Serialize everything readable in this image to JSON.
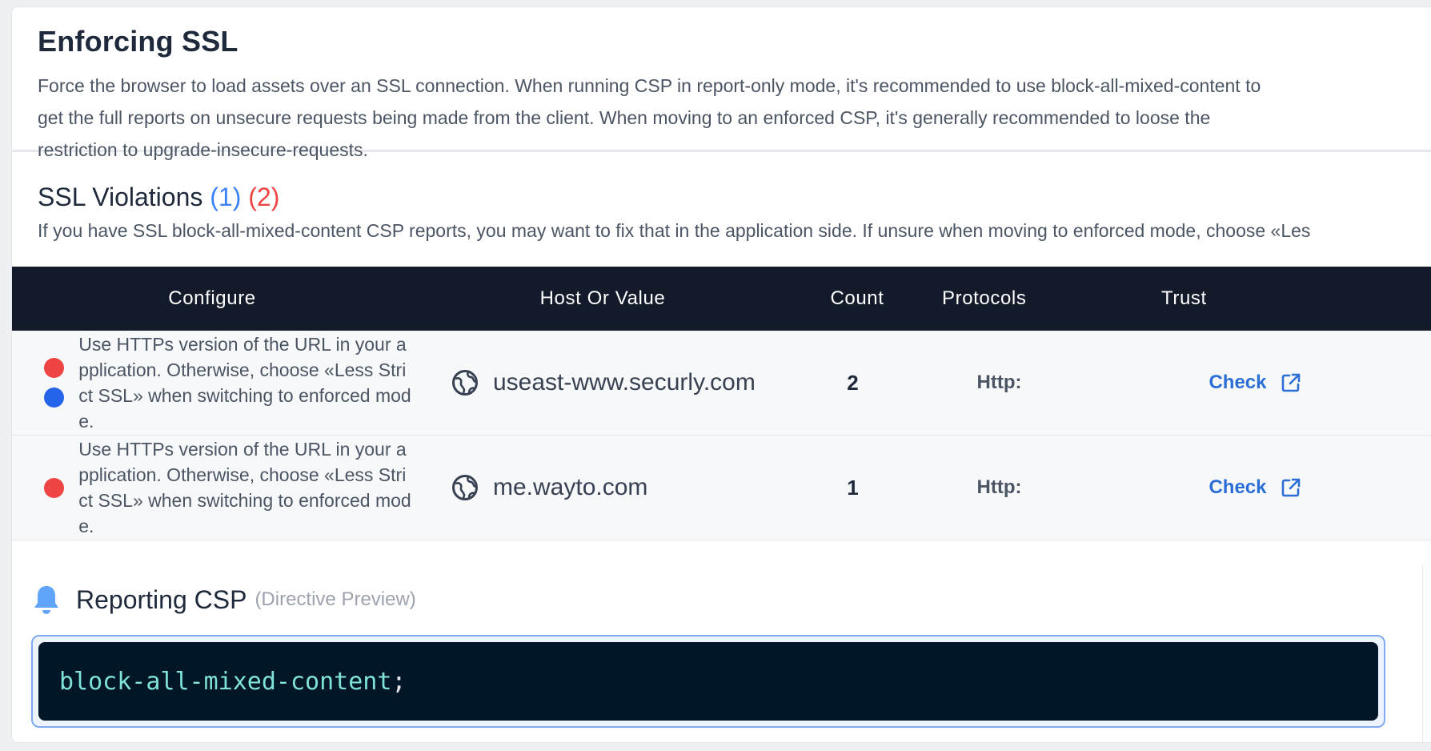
{
  "header": {
    "title": "Enforcing SSL",
    "description": "Force the browser to load assets over an SSL connection. When running CSP in report-only mode, it's recommended to use block-all-mixed-content to get the full reports on unsecure requests being made from the client. When moving to an enforced CSP, it's generally recommended to loose the restriction to upgrade-insecure-requests."
  },
  "ssl_violations": {
    "title": "SSL Violations",
    "count_blue": "(1)",
    "count_red": "(2)",
    "description": "If you have SSL block-all-mixed-content CSP reports, you may want to fix that in the application side. If unsure when moving to enforced mode, choose «Les"
  },
  "table": {
    "columns": [
      "Configure",
      "Host Or Value",
      "Count",
      "Protocols",
      "Trust"
    ],
    "rows": [
      {
        "configure": "Use HTTPs version of the URL in your application. Otherwise, choose «Less Strict SSL» when switching to enforced mode.",
        "dots": [
          "red",
          "blue"
        ],
        "host": "useast-www.securly.com",
        "count": "2",
        "protocols": "Http:",
        "trust": "Check"
      },
      {
        "configure": "Use HTTPs version of the URL in your application. Otherwise, choose «Less Strict SSL» when switching to enforced mode.",
        "dots": [
          "red"
        ],
        "host": "me.wayto.com",
        "count": "1",
        "protocols": "Http:",
        "trust": "Check"
      }
    ]
  },
  "reporting": {
    "icon": "bell-icon",
    "title": "Reporting CSP",
    "subtitle": "(Directive Preview)",
    "directive": "block-all-mixed-content",
    "terminator": ";"
  },
  "colors": {
    "accent_blue": "#3b82f6",
    "accent_red": "#ef4444",
    "table_header": "#131a2a",
    "code_bg": "#02162a",
    "code_text": "#7fe3d6",
    "link": "#2b6ed6"
  }
}
